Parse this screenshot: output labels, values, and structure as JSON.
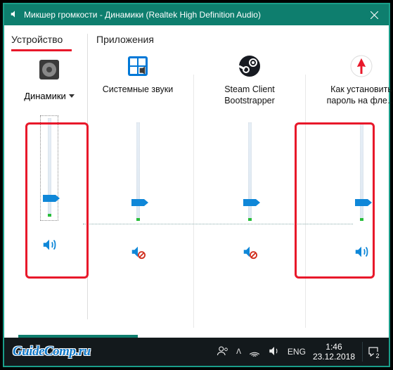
{
  "titlebar": {
    "title": "Микшер громкости - Динамики (Realtek High Definition Audio)",
    "close_label": "✕"
  },
  "sections": {
    "device_label": "Устройство",
    "apps_label": "Приложения"
  },
  "device": {
    "name": "Динамики",
    "volume_percent": 15,
    "muted": false
  },
  "apps": [
    {
      "name": "Системные звуки",
      "icon": "windows-sound-icon",
      "volume_percent": 15,
      "muted": true
    },
    {
      "name": "Steam Client Bootstrapper",
      "icon": "steam-icon",
      "volume_percent": 15,
      "muted": true
    },
    {
      "name": "Как установить пароль на фле…",
      "icon": "yandex-browser-icon",
      "volume_percent": 15,
      "muted": false
    }
  ],
  "taskbar": {
    "watermark": "GuideComp.ru",
    "language": "ENG",
    "time": "1:46",
    "date": "23.12.2018",
    "notif_count": "2",
    "chevron": "ᐱ"
  },
  "colors": {
    "accent": "#0e7e6e",
    "highlight": "#e8182a",
    "slider_thumb": "#0f87d8"
  }
}
